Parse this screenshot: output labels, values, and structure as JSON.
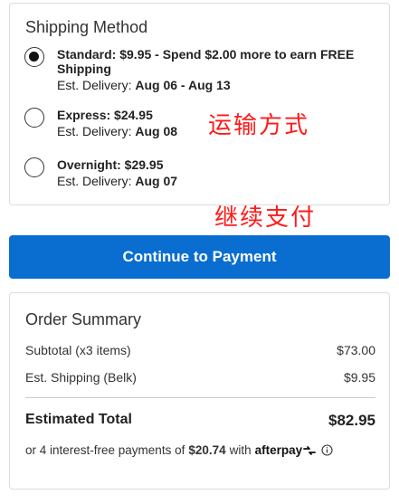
{
  "shipping": {
    "title": "Shipping Method",
    "options": [
      {
        "name": "Standard: $9.95 - Spend $2.00 more to earn FREE Shipping",
        "delivery_label": "Est. Delivery:",
        "delivery_dates": "Aug 06 - Aug 13",
        "selected": true
      },
      {
        "name": "Express: $24.95",
        "delivery_label": "Est. Delivery:",
        "delivery_dates": "Aug 08",
        "selected": false
      },
      {
        "name": "Overnight: $29.95",
        "delivery_label": "Est. Delivery:",
        "delivery_dates": "Aug 07",
        "selected": false
      }
    ]
  },
  "annotations": {
    "shipping_method": "运输方式",
    "continue_payment": "继续支付"
  },
  "continue_button": {
    "label": "Continue to Payment"
  },
  "summary": {
    "title": "Order Summary",
    "subtotal_label": "Subtotal (x3 items)",
    "subtotal_value": "$73.00",
    "shipping_label": "Est. Shipping (Belk)",
    "shipping_value": "$9.95",
    "total_label": "Estimated Total",
    "total_value": "$82.95",
    "installments_prefix": "or 4 interest-free payments of",
    "installments_amount": "$20.74",
    "installments_with": "with",
    "installments_brand": "afterpay"
  },
  "colors": {
    "accent": "#0a6ed1",
    "annotation": "#ff1a1a"
  }
}
